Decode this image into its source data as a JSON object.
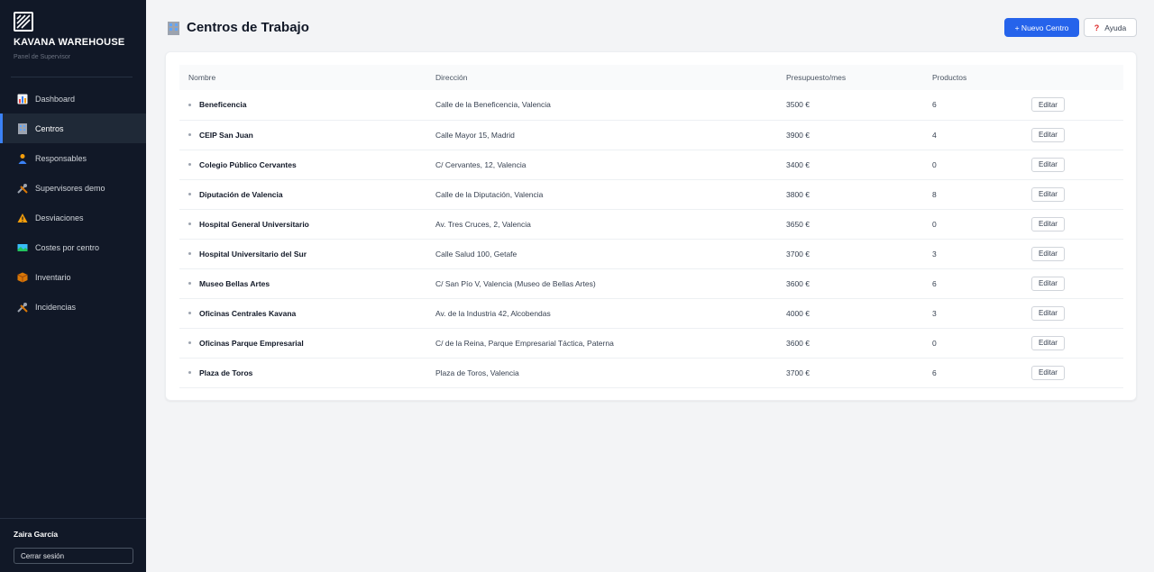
{
  "sidebar": {
    "brand": "KAVANA WAREHOUSE",
    "subtitle": "Panel de Supervisor",
    "items": [
      {
        "label": "Dashboard",
        "icon": "bar-chart-icon",
        "active": false
      },
      {
        "label": "Centros",
        "icon": "office-building-icon",
        "active": true
      },
      {
        "label": "Responsables",
        "icon": "person-icon",
        "active": false
      },
      {
        "label": "Supervisores demo",
        "icon": "tools-icon",
        "active": false
      },
      {
        "label": "Desviaciones",
        "icon": "warning-icon",
        "active": false
      },
      {
        "label": "Costes por centro",
        "icon": "map-icon",
        "active": false
      },
      {
        "label": "Inventario",
        "icon": "package-icon",
        "active": false
      },
      {
        "label": "Incidencias",
        "icon": "tools-icon",
        "active": false
      }
    ],
    "user_name": "Zaira García",
    "logout_label": "Cerrar sesión"
  },
  "header": {
    "title": "Centros de Trabajo",
    "new_button": "+ Nuevo Centro",
    "help_button": "Ayuda"
  },
  "table": {
    "columns": [
      "Nombre",
      "Dirección",
      "Presupuesto/mes",
      "Productos",
      ""
    ],
    "edit_label": "Editar",
    "rows": [
      {
        "name": "Beneficencia",
        "address": "Calle de la Beneficencia, Valencia",
        "budget": "3500 €",
        "products": "6"
      },
      {
        "name": "CEIP San Juan",
        "address": "Calle Mayor 15, Madrid",
        "budget": "3900 €",
        "products": "4"
      },
      {
        "name": "Colegio Público Cervantes",
        "address": "C/ Cervantes, 12, Valencia",
        "budget": "3400 €",
        "products": "0"
      },
      {
        "name": "Diputación de Valencia",
        "address": "Calle de la Diputación, Valencia",
        "budget": "3800 €",
        "products": "8"
      },
      {
        "name": "Hospital General Universitario",
        "address": "Av. Tres Cruces, 2, Valencia",
        "budget": "3650 €",
        "products": "0"
      },
      {
        "name": "Hospital Universitario del Sur",
        "address": "Calle Salud 100, Getafe",
        "budget": "3700 €",
        "products": "3"
      },
      {
        "name": "Museo Bellas Artes",
        "address": "C/ San Pío V, Valencia (Museo de Bellas Artes)",
        "budget": "3600 €",
        "products": "6"
      },
      {
        "name": "Oficinas Centrales Kavana",
        "address": "Av. de la Industria 42, Alcobendas",
        "budget": "4000 €",
        "products": "3"
      },
      {
        "name": "Oficinas Parque Empresarial",
        "address": "C/ de la Reina, Parque Empresarial Táctica, Paterna",
        "budget": "3600 €",
        "products": "0"
      },
      {
        "name": "Plaza de Toros",
        "address": "Plaza de Toros, Valencia",
        "budget": "3700 €",
        "products": "6"
      }
    ]
  },
  "colors": {
    "sidebar_bg": "#111827",
    "accent": "#2563eb",
    "page_bg": "#f3f4f6"
  }
}
